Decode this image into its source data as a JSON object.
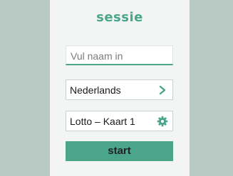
{
  "app": {
    "logo_text": "sessie"
  },
  "form": {
    "name_placeholder": "Vul naam in",
    "language_value": "Nederlands",
    "card_value": "Lotto – Kaart 1",
    "start_label": "start"
  },
  "icons": {
    "language_chevron": "chevron-right-icon",
    "card_settings": "gear-icon"
  },
  "colors": {
    "background": "#b9c9c4",
    "panel": "#f3f4f4",
    "accent": "#4aa58a"
  }
}
